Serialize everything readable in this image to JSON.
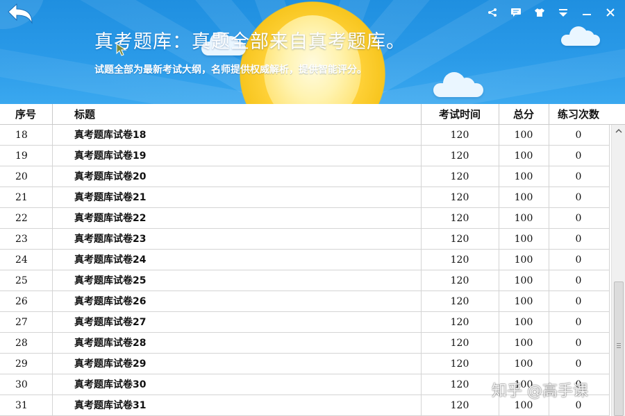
{
  "header": {
    "title": "真考题库：真题全部来自真考题库。",
    "subtitle": "试题全部为最新考试大纲，名师提供权威解析，提供智能评分。"
  },
  "window_controls": [
    "share-icon",
    "message-icon",
    "skin-icon",
    "menu-icon",
    "minimize-icon",
    "close-icon"
  ],
  "table": {
    "headers": {
      "no": "序号",
      "title": "标题",
      "time": "考试时间",
      "score": "总分",
      "count": "练习次数"
    },
    "rows": [
      {
        "no": "18",
        "title": "真考题库试卷18",
        "time": "120",
        "score": "100",
        "count": "0"
      },
      {
        "no": "19",
        "title": "真考题库试卷19",
        "time": "120",
        "score": "100",
        "count": "0"
      },
      {
        "no": "20",
        "title": "真考题库试卷20",
        "time": "120",
        "score": "100",
        "count": "0"
      },
      {
        "no": "21",
        "title": "真考题库试卷21",
        "time": "120",
        "score": "100",
        "count": "0"
      },
      {
        "no": "22",
        "title": "真考题库试卷22",
        "time": "120",
        "score": "100",
        "count": "0"
      },
      {
        "no": "23",
        "title": "真考题库试卷23",
        "time": "120",
        "score": "100",
        "count": "0"
      },
      {
        "no": "24",
        "title": "真考题库试卷24",
        "time": "120",
        "score": "100",
        "count": "0"
      },
      {
        "no": "25",
        "title": "真考题库试卷25",
        "time": "120",
        "score": "100",
        "count": "0"
      },
      {
        "no": "26",
        "title": "真考题库试卷26",
        "time": "120",
        "score": "100",
        "count": "0"
      },
      {
        "no": "27",
        "title": "真考题库试卷27",
        "time": "120",
        "score": "100",
        "count": "0"
      },
      {
        "no": "28",
        "title": "真考题库试卷28",
        "time": "120",
        "score": "100",
        "count": "0"
      },
      {
        "no": "29",
        "title": "真考题库试卷29",
        "time": "120",
        "score": "100",
        "count": "0"
      },
      {
        "no": "30",
        "title": "真考题库试卷30",
        "time": "120",
        "score": "100",
        "count": "0"
      },
      {
        "no": "31",
        "title": "真考题库试卷31",
        "time": "120",
        "score": "100",
        "count": "0"
      }
    ]
  },
  "watermark": "知乎 @高手课",
  "colors": {
    "header_blue": "#2a9ae8",
    "sun": "#ffd23a",
    "grid_line": "#d4d4d4"
  }
}
